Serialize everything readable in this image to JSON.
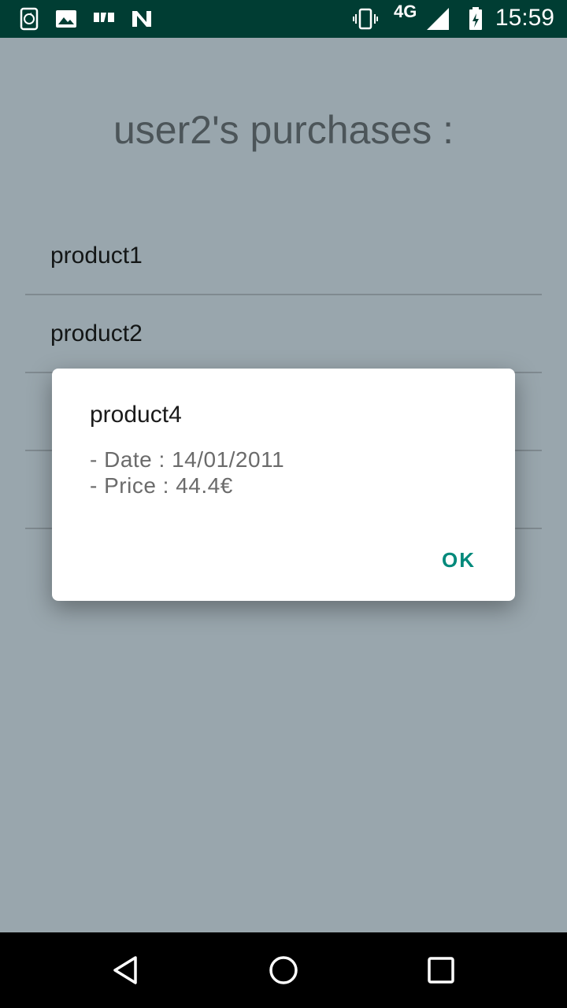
{
  "status_bar": {
    "time": "15:59",
    "network": "4G",
    "icons": [
      "phone-sync-icon",
      "image-icon",
      "app-logo-icon",
      "n-icon",
      "vibrate-icon",
      "signal-icon",
      "battery-charging-icon"
    ]
  },
  "screen": {
    "title": "user2's purchases :",
    "items": [
      {
        "label": "product1"
      },
      {
        "label": "product2"
      },
      {
        "label": ""
      },
      {
        "label": ""
      }
    ]
  },
  "dialog": {
    "title": "product4",
    "line1": "- Date : 14/01/2011",
    "line2": "- Price : 44.4€",
    "ok_label": "OK"
  },
  "colors": {
    "status_bar": "#003d33",
    "scrim_background": "#99a6ad",
    "accent": "#00897b"
  }
}
